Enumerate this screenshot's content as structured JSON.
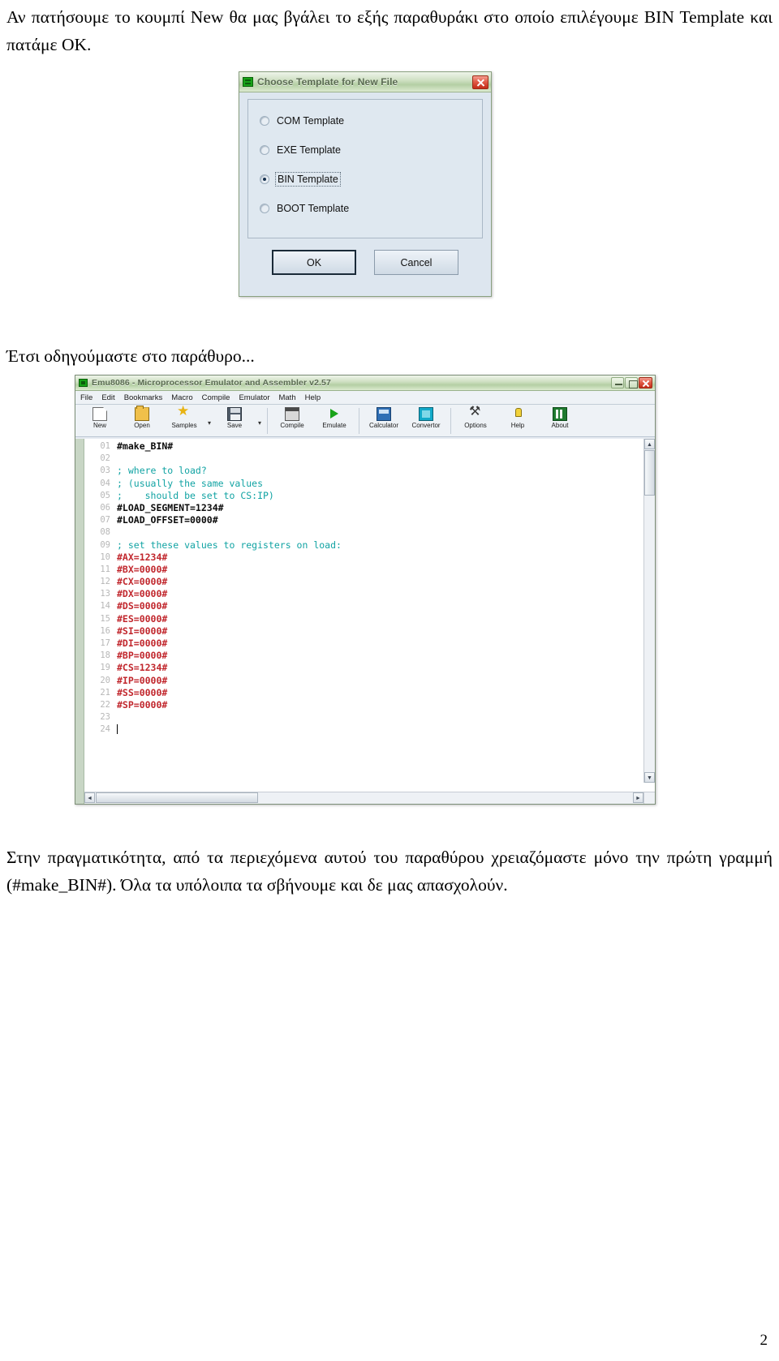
{
  "document": {
    "intro_paragraph": "Αν πατήσουμε το κουμπί New θα μας βγάλει το εξής παραθυράκι στο οποίο επιλέγουμε BIN Template και πατάμε OK.",
    "mid_paragraph": "Έτσι οδηγούμαστε στο παράθυρο...",
    "outro_paragraph": "Στην πραγματικότητα, από τα περιεχόμενα αυτού του παραθύρου χρειαζόμαστε μόνο την πρώτη γραμμή (#make_BIN#). Όλα τα υπόλοιπα τα σβήνουμε και δε μας απασχολούν.",
    "page_number": "2"
  },
  "template_dialog": {
    "title": "Choose Template for New File",
    "icon": "green-chip-icon",
    "close_label": "close-icon",
    "options": [
      {
        "label": "COM Template",
        "selected": false
      },
      {
        "label": "EXE Template",
        "selected": false
      },
      {
        "label": "BIN Template",
        "selected": true
      },
      {
        "label": "BOOT Template",
        "selected": false
      }
    ],
    "buttons": {
      "ok": "OK",
      "cancel": "Cancel"
    }
  },
  "emu_window": {
    "title": "Emu8086 - Microprocessor Emulator and Assembler v2.57",
    "icon": "green-chip-icon",
    "menu": [
      "File",
      "Edit",
      "Bookmarks",
      "Macro",
      "Compile",
      "Emulator",
      "Math",
      "Help"
    ],
    "toolbar": [
      {
        "label": "New",
        "icon": "new-file-icon",
        "dropdown": false
      },
      {
        "label": "Open",
        "icon": "open-folder-icon",
        "dropdown": false
      },
      {
        "label": "Samples",
        "icon": "star-icon",
        "dropdown": true
      },
      {
        "label": "Save",
        "icon": "floppy-icon",
        "dropdown": true
      },
      {
        "label": "Compile",
        "icon": "compile-icon",
        "dropdown": false
      },
      {
        "label": "Emulate",
        "icon": "play-icon",
        "dropdown": false
      },
      {
        "label": "Calculator",
        "icon": "calculator-icon",
        "dropdown": false
      },
      {
        "label": "Convertor",
        "icon": "convertor-icon",
        "dropdown": false
      },
      {
        "label": "Options",
        "icon": "tools-icon",
        "dropdown": false
      },
      {
        "label": "Help",
        "icon": "lightbulb-icon",
        "dropdown": false
      },
      {
        "label": "About",
        "icon": "about-icon",
        "dropdown": false
      }
    ],
    "dropdown_marker": "▾",
    "editor": {
      "lines": [
        {
          "num": "01",
          "text": "#make_BIN#",
          "style": "dir"
        },
        {
          "num": "02",
          "text": "",
          "style": "plain"
        },
        {
          "num": "03",
          "text": "; where to load?",
          "style": "com"
        },
        {
          "num": "04",
          "text": "; (usually the same values",
          "style": "com"
        },
        {
          "num": "05",
          "text": ";    should be set to CS:IP)",
          "style": "com"
        },
        {
          "num": "06",
          "text": "#LOAD_SEGMENT=1234#",
          "style": "dir"
        },
        {
          "num": "07",
          "text": "#LOAD_OFFSET=0000#",
          "style": "dir"
        },
        {
          "num": "08",
          "text": "",
          "style": "plain"
        },
        {
          "num": "09",
          "text": "; set these values to registers on load:",
          "style": "com"
        },
        {
          "num": "10",
          "text": "#AX=1234#",
          "style": "reg"
        },
        {
          "num": "11",
          "text": "#BX=0000#",
          "style": "reg"
        },
        {
          "num": "12",
          "text": "#CX=0000#",
          "style": "reg"
        },
        {
          "num": "13",
          "text": "#DX=0000#",
          "style": "reg"
        },
        {
          "num": "14",
          "text": "#DS=0000#",
          "style": "reg"
        },
        {
          "num": "15",
          "text": "#ES=0000#",
          "style": "reg"
        },
        {
          "num": "16",
          "text": "#SI=0000#",
          "style": "reg"
        },
        {
          "num": "17",
          "text": "#DI=0000#",
          "style": "reg"
        },
        {
          "num": "18",
          "text": "#BP=0000#",
          "style": "reg"
        },
        {
          "num": "19",
          "text": "#CS=1234#",
          "style": "reg"
        },
        {
          "num": "20",
          "text": "#IP=0000#",
          "style": "reg"
        },
        {
          "num": "21",
          "text": "#SS=0000#",
          "style": "reg"
        },
        {
          "num": "22",
          "text": "#SP=0000#",
          "style": "reg"
        },
        {
          "num": "23",
          "text": "",
          "style": "plain"
        },
        {
          "num": "24",
          "text": "",
          "style": "plain",
          "caret": true
        }
      ]
    },
    "scroll": {
      "up_arrow": "▲",
      "down_arrow": "▼",
      "left_arrow": "◄",
      "right_arrow": "►"
    }
  },
  "colors": {
    "title_green": "#b4cfa4",
    "comment_teal": "#11a3a3",
    "register_red": "#c1272d",
    "close_red": "#c32c18"
  }
}
